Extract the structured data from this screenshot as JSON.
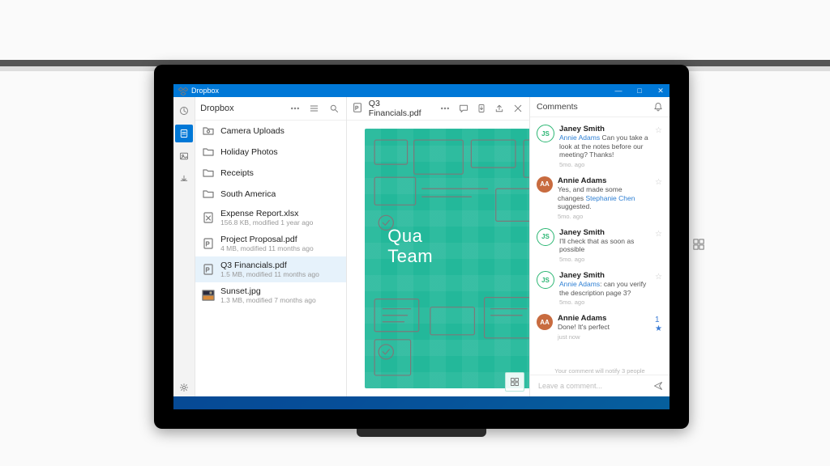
{
  "window": {
    "title": "Dropbox",
    "minimize_glyph": "—",
    "maximize_glyph": "□",
    "close_glyph": "✕"
  },
  "sidebar": {
    "title": "Dropbox",
    "items": [
      {
        "kind": "folder_camera",
        "name": "Camera Uploads"
      },
      {
        "kind": "folder",
        "name": "Holiday Photos"
      },
      {
        "kind": "folder",
        "name": "Receipts"
      },
      {
        "kind": "folder",
        "name": "South America"
      },
      {
        "kind": "xlsx",
        "name": "Expense Report.xlsx",
        "meta": "156.8 KB, modified 1 year ago"
      },
      {
        "kind": "pdf",
        "name": "Project Proposal.pdf",
        "meta": "4 MB, modified 11 months ago"
      },
      {
        "kind": "pdf",
        "name": "Q3 Financials.pdf",
        "meta": "1.5 MB, modified 11 months ago",
        "selected": true
      },
      {
        "kind": "image",
        "name": "Sunset.jpg",
        "meta": "1.3 MB, modified 7 months ago"
      }
    ]
  },
  "preview": {
    "title": "Q3 Financials.pdf",
    "hero_line1": "Qua",
    "hero_line2": "Team "
  },
  "comments": {
    "header": "Comments",
    "bell_glyph": "🔔",
    "notify_text": "Your comment will notify 3 people",
    "compose_placeholder": "Leave a comment...",
    "items": [
      {
        "avatar": "JS",
        "avatar_style": "js-out",
        "author": "Janey Smith",
        "mention": "Annie Adams",
        "body": " Can you take a look at the notes before our meeting? Thanks!",
        "when": "5mo. ago",
        "starred": false
      },
      {
        "avatar": "AA",
        "avatar_style": "aa",
        "author": "Annie Adams",
        "body_prefix": "Yes, and made some changes ",
        "mention": "Stephanie Chen",
        "body_suffix": " suggested.",
        "when": "5mo. ago",
        "starred": false
      },
      {
        "avatar": "JS",
        "avatar_style": "js-out",
        "author": "Janey Smith",
        "body": "I'll check that as soon as possible",
        "when": "5mo. ago",
        "starred": false
      },
      {
        "avatar": "JS",
        "avatar_style": "js-out",
        "author": "Janey Smith",
        "mention": "Annie Adams",
        "body": ": can you verify the description page 3?",
        "when": "5mo. ago",
        "starred": false
      },
      {
        "avatar": "AA",
        "avatar_style": "aa",
        "author": "Annie Adams",
        "body": "Done! It's perfect",
        "when": "just now",
        "starred": true,
        "star_count": "1"
      }
    ]
  }
}
